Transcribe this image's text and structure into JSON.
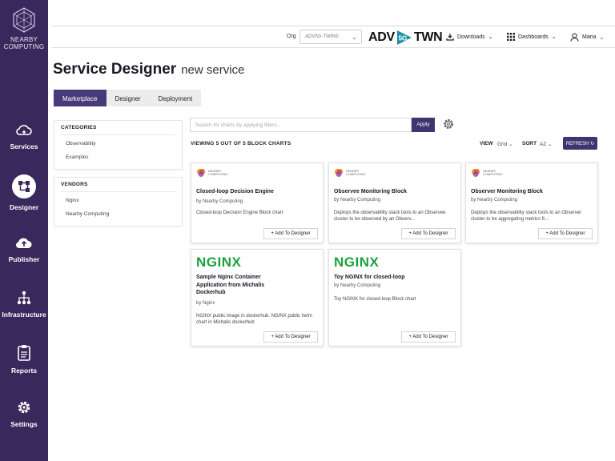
{
  "sidebar": {
    "logo_text": [
      "NEARBY",
      "COMPUTING"
    ],
    "items": [
      {
        "label": "Services",
        "icon": "cloud-icon"
      },
      {
        "label": "Designer",
        "icon": "designer-icon"
      },
      {
        "label": "Publisher",
        "icon": "cloud-upload-icon"
      },
      {
        "label": "Infrastructure",
        "icon": "network-icon"
      },
      {
        "label": "Reports",
        "icon": "clipboard-icon"
      },
      {
        "label": "Settings",
        "icon": "gear-icon"
      }
    ],
    "active": "Designer",
    "bg_color": "#38285c"
  },
  "topbar": {
    "org_label": "Org",
    "org_value": "ADV5G-TWINS",
    "brand_left": "ADV",
    "brand_mid": "5G",
    "brand_right": "TWN",
    "downloads": "Downloads",
    "dashboards": "Dashboards",
    "user": "Maria"
  },
  "page": {
    "title": "Service Designer",
    "subtitle": "new service"
  },
  "tabs": [
    "Marketplace",
    "Designer",
    "Deployment"
  ],
  "filters": {
    "categories_title": "CATEGORIES",
    "categories": [
      "Observability",
      "Examples"
    ],
    "vendors_title": "VENDORS",
    "vendors": [
      "Nginx",
      "Nearby Computing"
    ]
  },
  "search": {
    "placeholder": "Search for charts by applying filters...",
    "apply_label": "Apply"
  },
  "results": {
    "viewing": "VIEWING 5 OUT OF 5 BLOCK CHARTS",
    "view_label": "VIEW",
    "view_value": "Grid",
    "sort_label": "SORT",
    "sort_value": "AZ",
    "refresh_label": "REFRESH"
  },
  "cards": [
    {
      "logo": "nearby",
      "logo_text": [
        "NEARBY",
        "COMPUTING"
      ],
      "title": "Closed-loop Decision Engine",
      "by": "by Nearby Computing",
      "desc": "Closed-loop Decision Engine Block chart",
      "button": "+ Add To Designer"
    },
    {
      "logo": "nearby",
      "logo_text": [
        "NEARBY",
        "COMPUTING"
      ],
      "title": "Observee Monitoring Block",
      "by": "by Nearby Computing",
      "desc": "Deploys the observability stack tools to an Observee cluster to be observed by an Observ...",
      "button": "+ Add To Designer"
    },
    {
      "logo": "nearby",
      "logo_text": [
        "NEARBY",
        "COMPUTING"
      ],
      "title": "Observer Monitoring Block",
      "by": "by Nearby Computing",
      "desc": "Deploys the observability stack tools to an Observer cluster to be aggregating metrics fr...",
      "button": "+ Add To Designer"
    },
    {
      "logo": "nginx",
      "logo_text": [
        "NGINX"
      ],
      "title": "Sample Nginx Container Application from Michalis Dockerhub",
      "by": "by Nginx",
      "desc": "NGINX public image in dockerhub. NGINX public helm chart in Michalis dockerhub",
      "button": "+ Add To Designer"
    },
    {
      "logo": "nginx",
      "logo_text": [
        "NGINX"
      ],
      "title": "Toy NGINX for closed-loop",
      "by": "by Nearby Computing",
      "desc": "Toy NGINX for closed-loop Block chart",
      "button": "+ Add To Designer"
    }
  ],
  "colors": {
    "accent": "#3f3570",
    "nginx_green": "#1aa33c",
    "brand_teal": "#1c8fa6"
  }
}
